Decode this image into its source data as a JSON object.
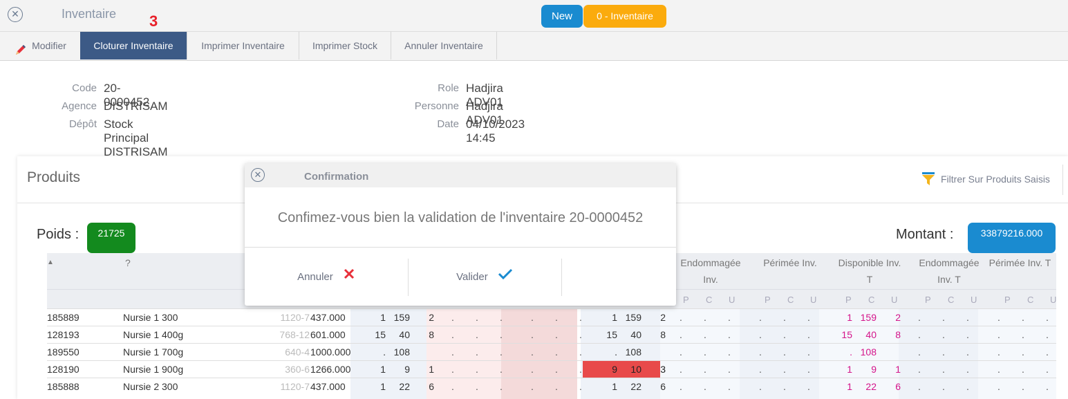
{
  "header": {
    "close_icon": "close-circle-icon",
    "title": "Inventaire",
    "step_marker": "3",
    "new_label": "New",
    "status_label": "0 - Inventaire"
  },
  "toolbar": {
    "modifier": "Modifier",
    "cloturer": "Cloturer Inventaire",
    "imprimer_inventaire": "Imprimer Inventaire",
    "imprimer_stock": "Imprimer Stock",
    "annuler_inventaire": "Annuler Inventaire"
  },
  "info": {
    "code_label": "Code",
    "code": "20-0000452",
    "agence_label": "Agence",
    "agence": "DISTRISAM",
    "depot_label": "Dépôt",
    "depot": "Stock Principal DISTRISAM",
    "role_label": "Role",
    "role": "Hadjira ADV01",
    "personne_label": "Personne",
    "personne": "Hadjira ADV01",
    "date_label": "Date",
    "date": "04/10/2023 14:45"
  },
  "produits": {
    "title": "Produits",
    "filter_label": "Filtrer Sur Produits Saisis",
    "poids_label": "Poids :",
    "poids_value": "21725",
    "montant_label": "Montant :",
    "montant_value": "33879216.000"
  },
  "table": {
    "col_question": "?",
    "headers": [
      "Endommagée",
      "Inv.",
      "Périmée Inv.",
      "Disponible Inv.",
      "T",
      "Endommagée",
      "Inv. T",
      "Périmée Inv. T"
    ],
    "pcu": [
      "P",
      "C",
      "U"
    ],
    "rows": [
      {
        "code": "185889",
        "name": "Nursie 1 300",
        "ref": "1120-7",
        "price": "437.000",
        "a": [
          "1",
          "159",
          "2"
        ],
        "b": [
          "1",
          "159",
          "2"
        ],
        "c": [
          "1",
          "159",
          "2"
        ]
      },
      {
        "code": "128193",
        "name": "Nursie 1 400g",
        "ref": "768-12",
        "price": "601.000",
        "a": [
          "15",
          "40",
          "8"
        ],
        "b": [
          "15",
          "40",
          "8"
        ],
        "c": [
          "15",
          "40",
          "8"
        ]
      },
      {
        "code": "189550",
        "name": "Nursie 1 700g",
        "ref": "640-4",
        "price": "1000.000",
        "a": [
          ".",
          "108",
          ""
        ],
        "b": [
          ".",
          "108",
          ""
        ],
        "c": [
          ".",
          "108",
          ""
        ]
      },
      {
        "code": "128190",
        "name": "Nursie 1 900g",
        "ref": "360-6",
        "price": "1266.000",
        "a": [
          "1",
          "9",
          "1"
        ],
        "b": [
          "9",
          "10",
          "3"
        ],
        "c": [
          "1",
          "9",
          "1"
        ]
      },
      {
        "code": "185888",
        "name": "Nursie 2 300",
        "ref": "1120-7",
        "price": "437.000",
        "a": [
          "1",
          "22",
          "6"
        ],
        "b": [
          "1",
          "22",
          "6"
        ],
        "c": [
          "1",
          "22",
          "6"
        ]
      }
    ]
  },
  "modal": {
    "title": "Confirmation",
    "message": "Confimez-vous bien la validation de l'inventaire 20-0000452",
    "cancel_label": "Annuler",
    "confirm_label": "Valider"
  },
  "colors": {
    "accent_blue": "#1a8bd0",
    "status_orange": "#fbab0d",
    "active_tab": "#3c5a86",
    "poids_green": "#138a1e",
    "alert_red": "#e84a4a",
    "magenta_text": "#d4148a"
  }
}
